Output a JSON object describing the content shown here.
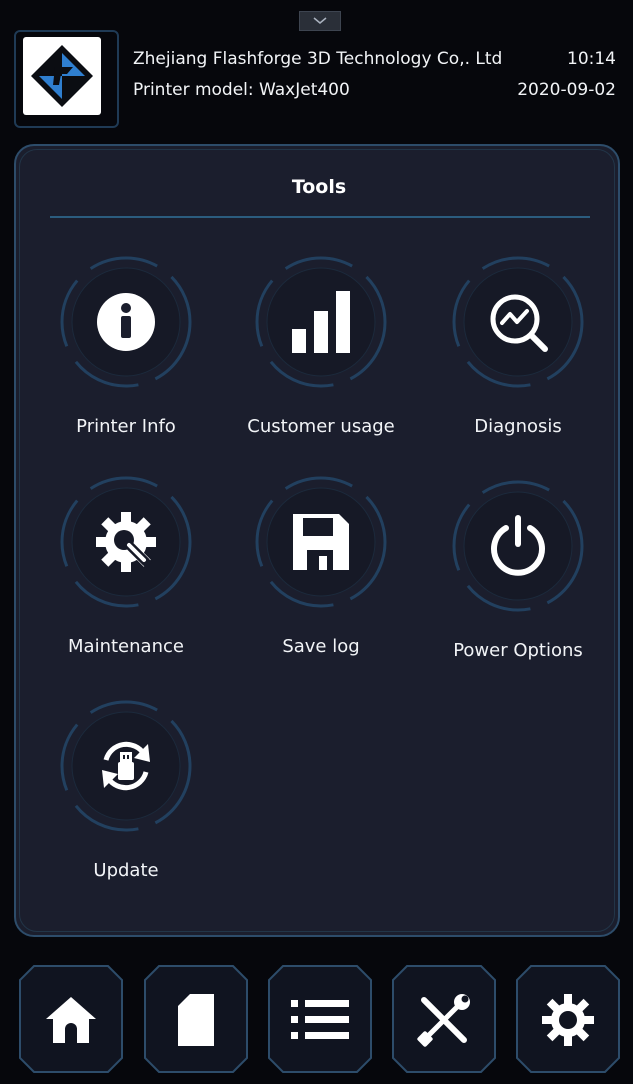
{
  "header": {
    "company": "Zhejiang Flashforge 3D Technology Co,. Ltd",
    "model": "Printer model:  WaxJet400",
    "time": "10:14",
    "date": "2020-09-02",
    "logo_icon": "flashforge-logo-icon",
    "pulldown_icon": "chevron-down-icon"
  },
  "tools": {
    "title": "Tools",
    "items": [
      {
        "label": "Printer Info",
        "icon": "info-icon"
      },
      {
        "label": "Customer usage",
        "icon": "bar-chart-icon"
      },
      {
        "label": "Diagnosis",
        "icon": "diagnosis-icon"
      },
      {
        "label": "Maintenance",
        "icon": "gear-wrench-icon"
      },
      {
        "label": "Save log",
        "icon": "floppy-disk-icon"
      },
      {
        "label": "Power Options",
        "icon": "power-icon"
      },
      {
        "label": "Update",
        "icon": "usb-update-icon"
      }
    ]
  },
  "nav": {
    "items": [
      {
        "name": "home",
        "icon": "home-icon"
      },
      {
        "name": "files",
        "icon": "file-icon"
      },
      {
        "name": "list",
        "icon": "list-icon"
      },
      {
        "name": "tools",
        "icon": "tools-icon"
      },
      {
        "name": "settings",
        "icon": "gear-icon"
      }
    ]
  },
  "colors": {
    "background": "#06070c",
    "panel": "#1b1e2d",
    "accent": "#2d4c6a",
    "logo_blue": "#2f7fd0",
    "icon": "#ffffff"
  }
}
